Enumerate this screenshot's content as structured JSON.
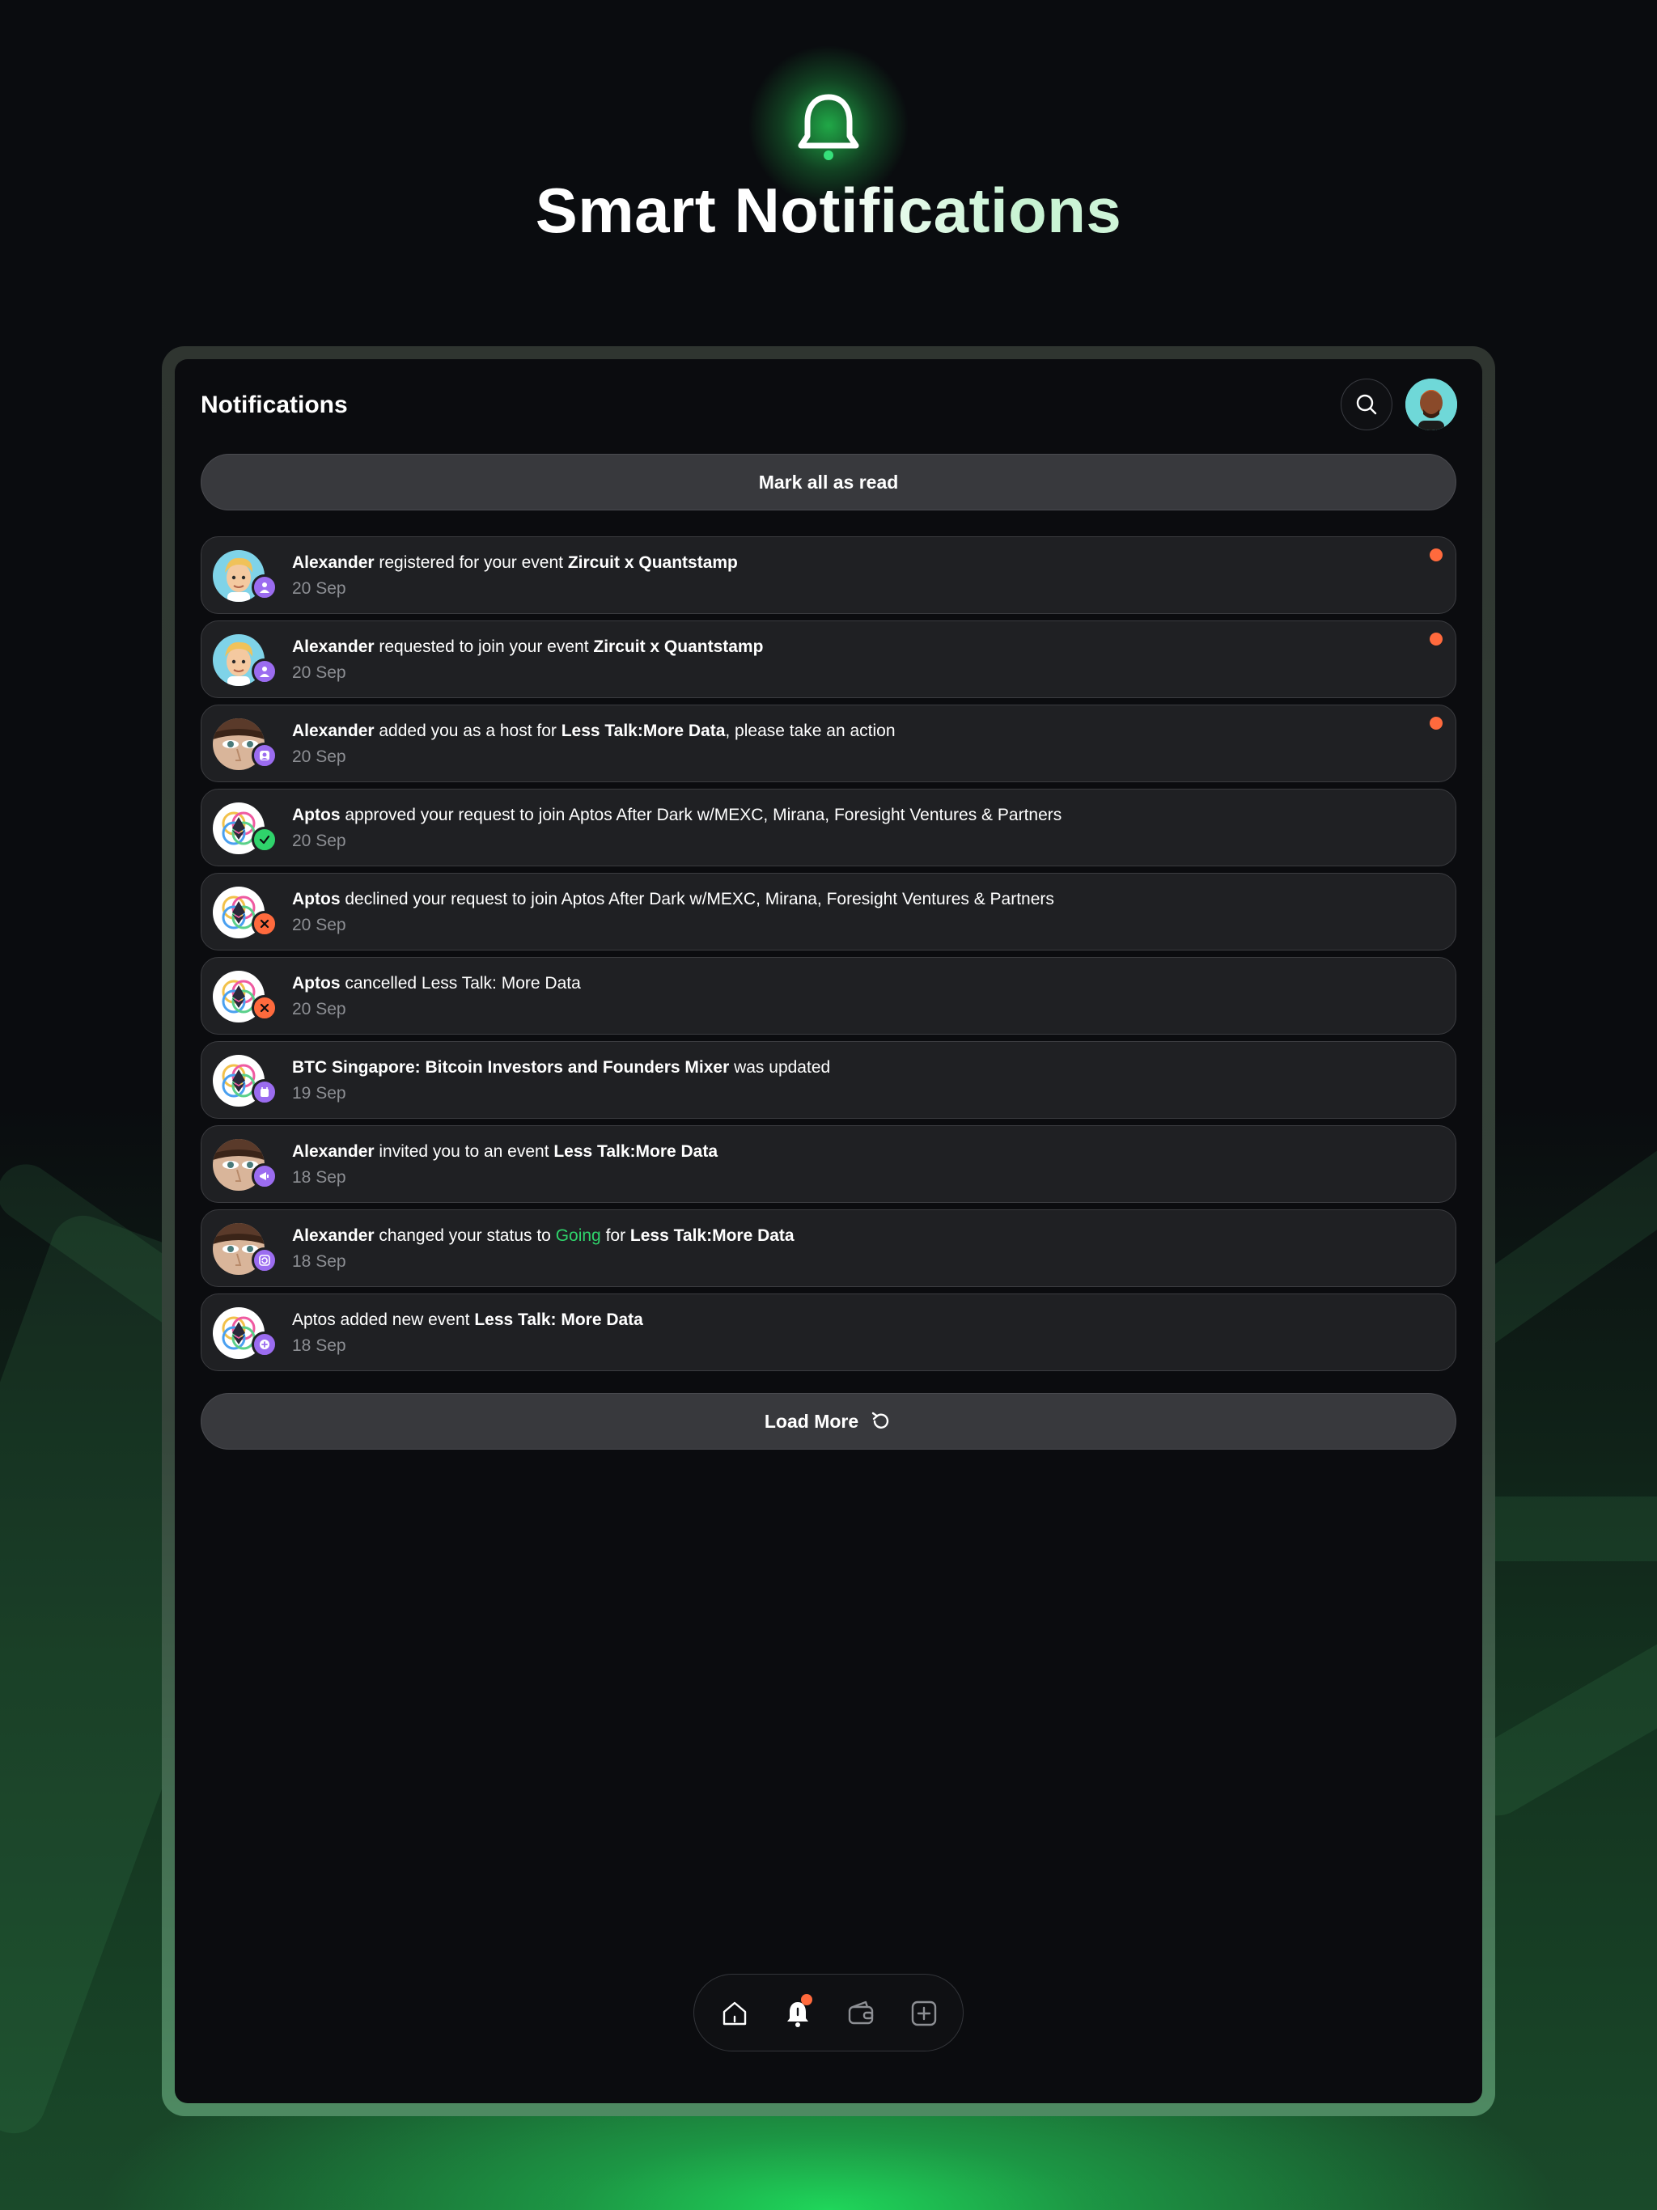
{
  "hero": {
    "title": "Smart Notifications",
    "icon": "bell-icon"
  },
  "header": {
    "title": "Notifications",
    "search_icon": "search-icon",
    "avatar": "user-avatar"
  },
  "actions": {
    "mark_all_read": "Mark all as read",
    "load_more": "Load More",
    "load_more_icon": "refresh-icon"
  },
  "colors": {
    "unread_dot": "#ff6a3d",
    "accent_green": "#2fd36b",
    "badge_purple": "#9b6cf0",
    "badge_red": "#ff6a3d"
  },
  "notifications": [
    {
      "actor": "Alexander",
      "mid": " registered for your event ",
      "target": "Zircuit x Quantstamp",
      "tail": "",
      "date": "20 Sep",
      "unread": true,
      "avatar": "memoji",
      "badge": "user-icon"
    },
    {
      "actor": "Alexander",
      "mid": " requested to join your event ",
      "target": "Zircuit x Quantstamp",
      "tail": "",
      "date": "20 Sep",
      "unread": true,
      "avatar": "memoji",
      "badge": "user-icon"
    },
    {
      "actor": "Alexander",
      "mid": " added you as a host for ",
      "target": "Less Talk:More Data",
      "tail": ", please take an action",
      "date": "20 Sep",
      "unread": true,
      "avatar": "photo",
      "badge": "host-icon"
    },
    {
      "actor": "Aptos",
      "mid": " approved your request to join Aptos After Dark w/MEXC, Mirana, Foresight Ventures & Partners",
      "target": "",
      "tail": "",
      "date": "20 Sep",
      "unread": false,
      "avatar": "logo",
      "badge": "check-icon"
    },
    {
      "actor": "Aptos",
      "mid": " declined your request to join Aptos After Dark w/MEXC, Mirana, Foresight Ventures & Partners",
      "target": "",
      "tail": "",
      "date": "20 Sep",
      "unread": false,
      "avatar": "logo",
      "badge": "x-icon"
    },
    {
      "actor": "Aptos",
      "mid": " cancelled Less Talk: More Data",
      "target": "",
      "tail": "",
      "date": "20 Sep",
      "unread": false,
      "avatar": "logo",
      "badge": "x-icon"
    },
    {
      "actor": "BTC Singapore: Bitcoin Investors and Founders Mixer",
      "mid": " was updated",
      "target": "",
      "tail": "",
      "date": "19 Sep",
      "unread": false,
      "avatar": "logo",
      "badge": "calendar-icon"
    },
    {
      "actor": "Alexander",
      "mid": " invited you to an event ",
      "target": "Less Talk:More Data",
      "tail": "",
      "date": "18 Sep",
      "unread": false,
      "avatar": "photo",
      "badge": "megaphone-icon"
    },
    {
      "actor": "Alexander",
      "mid": " changed your status to ",
      "status": "Going",
      "mid2": " for ",
      "target": "Less Talk:More Data",
      "tail": "",
      "date": "18 Sep",
      "unread": false,
      "avatar": "photo",
      "badge": "sync-icon"
    },
    {
      "actor": "",
      "plain": "Aptos added new event ",
      "mid": "",
      "target": "Less Talk: More Data",
      "tail": "",
      "date": "18 Sep",
      "unread": false,
      "avatar": "logo",
      "badge": "plus-icon"
    }
  ],
  "tabbar": [
    {
      "name": "home",
      "icon": "home-icon",
      "active": false
    },
    {
      "name": "notifications",
      "icon": "bell-icon",
      "active": true,
      "has_dot": true
    },
    {
      "name": "wallet",
      "icon": "wallet-icon",
      "active": false
    },
    {
      "name": "create",
      "icon": "plus-square-icon",
      "active": false
    }
  ]
}
